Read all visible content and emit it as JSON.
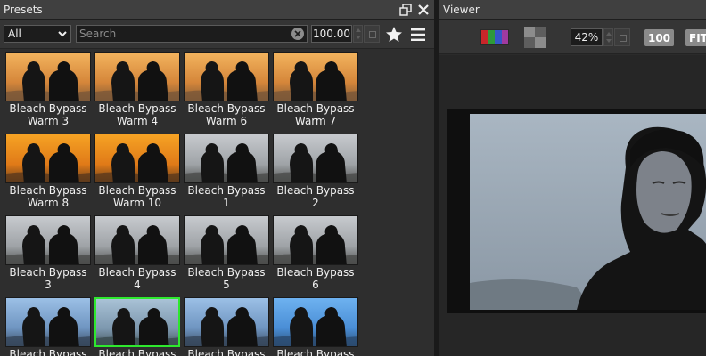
{
  "presets_panel": {
    "title": "Presets",
    "filter": {
      "selected": "All"
    },
    "search": {
      "placeholder": "Search",
      "value": ""
    },
    "amount": "100.00",
    "icons": [
      "restore-window-icon",
      "close-icon",
      "chevron-down-icon",
      "clear-icon",
      "star-icon",
      "menu-icon"
    ],
    "presets": [
      {
        "label": "Bleach Bypass Warm 3",
        "tone": "warm"
      },
      {
        "label": "Bleach Bypass Warm 4",
        "tone": "warm"
      },
      {
        "label": "Bleach Bypass Warm 6",
        "tone": "warm"
      },
      {
        "label": "Bleach Bypass Warm 7",
        "tone": "warm"
      },
      {
        "label": "Bleach Bypass Warm 8",
        "tone": "hot"
      },
      {
        "label": "Bleach Bypass Warm 10",
        "tone": "hot"
      },
      {
        "label": "Bleach Bypass 1",
        "tone": "neutral"
      },
      {
        "label": "Bleach Bypass 2",
        "tone": "neutral"
      },
      {
        "label": "Bleach Bypass 3",
        "tone": "neutral"
      },
      {
        "label": "Bleach Bypass 4",
        "tone": "neutral"
      },
      {
        "label": "Bleach Bypass 5",
        "tone": "neutral"
      },
      {
        "label": "Bleach Bypass 6",
        "tone": "neutral"
      },
      {
        "label": "Bleach Bypass",
        "tone": "cool",
        "selected": false
      },
      {
        "label": "Bleach Bypass",
        "tone": "cool-green",
        "selected": true
      },
      {
        "label": "Bleach Bypass",
        "tone": "cool",
        "selected": false
      },
      {
        "label": "Bleach Bypass",
        "tone": "cool-bright",
        "selected": false
      }
    ]
  },
  "viewer_panel": {
    "title": "Viewer",
    "zoom": "42%",
    "btn_100": "100",
    "btn_fit": "FIT",
    "icons": [
      "rgb-channels-icon",
      "checkerboard-icon"
    ]
  },
  "colors": {
    "selection": "#2ee82e",
    "panel_bg": "#2e2e2e",
    "header_bg": "#404040"
  }
}
